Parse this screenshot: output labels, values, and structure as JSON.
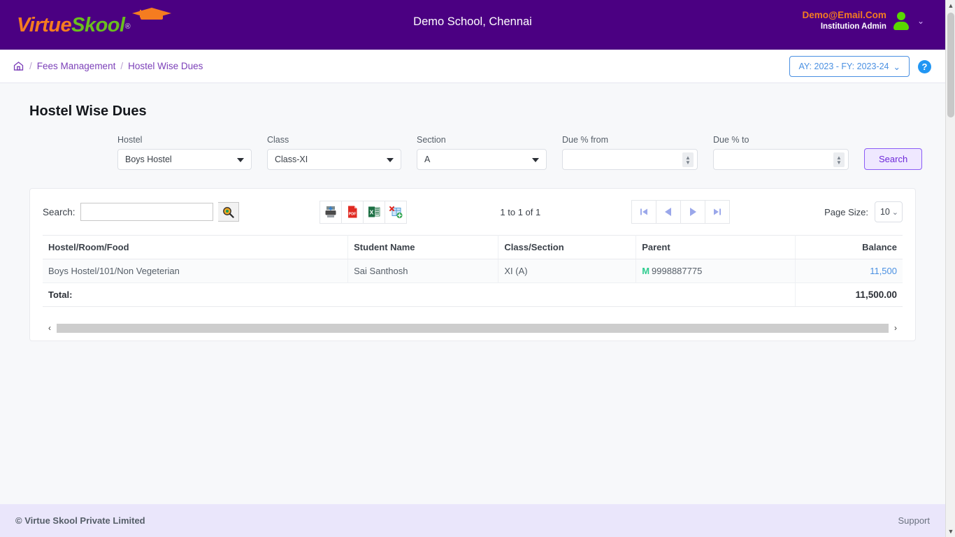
{
  "header": {
    "logo_virtue": "Virtue",
    "logo_skool": "Skool",
    "logo_reg": "®",
    "school_title": "Demo School, Chennai",
    "user_email": "Demo@Email.Com",
    "user_role": "Institution Admin",
    "brand_purple": "#4b0082",
    "brand_orange": "#f57c20",
    "brand_green": "#6abf1e"
  },
  "breadcrumb": {
    "home_label": "Home",
    "sep": "/",
    "items": [
      {
        "label": "Fees Management"
      },
      {
        "label": "Hostel Wise Dues"
      }
    ],
    "ay_button": "AY: 2023 - FY: 2023-24",
    "ay_caret": "⌄",
    "help_label": "?"
  },
  "main": {
    "page_title": "Hostel Wise Dues",
    "filters": [
      {
        "label": "Hostel",
        "value": "Boys Hostel",
        "type": "select"
      },
      {
        "label": "Class",
        "value": "Class-XI",
        "type": "select"
      },
      {
        "label": "Section",
        "value": "A",
        "type": "select"
      },
      {
        "label": "Due % from",
        "value": "",
        "placeholder": "",
        "type": "number"
      },
      {
        "label": "Due % to",
        "value": "",
        "placeholder": "",
        "type": "number"
      }
    ],
    "search_button": "Search"
  },
  "grid": {
    "search_label": "Search:",
    "search_value": "",
    "search_placeholder": "",
    "tools": [
      {
        "name": "print-icon",
        "title": "Print"
      },
      {
        "name": "pdf-icon",
        "title": "PDF"
      },
      {
        "name": "excel-icon",
        "title": "Excel"
      },
      {
        "name": "csv-icon",
        "title": "CSV"
      }
    ],
    "count_text": "1 to 1 of 1",
    "pager": [
      {
        "name": "first-page-button",
        "glyph": "⏮"
      },
      {
        "name": "prev-page-button",
        "glyph": "◀"
      },
      {
        "name": "next-page-button",
        "glyph": "▶"
      },
      {
        "name": "last-page-button",
        "glyph": "⏭"
      }
    ],
    "page_size_label": "Page Size:",
    "page_size_value": "10",
    "columns": [
      "Hostel/Room/Food",
      "Student Name",
      "Class/Section",
      "Parent",
      "Balance"
    ],
    "rows": [
      {
        "hostel_room_food": "Boys Hostel/101/Non Vegeterian",
        "student_name": "Sai Santhosh",
        "class_section": "XI (A)",
        "parent_badge": "M",
        "parent_phone": "9998887775",
        "balance": "11,500"
      }
    ],
    "total_label": "Total:",
    "total_balance": "11,500.00"
  },
  "footer": {
    "copyright": "© Virtue Skool Private Limited",
    "support": "Support"
  }
}
